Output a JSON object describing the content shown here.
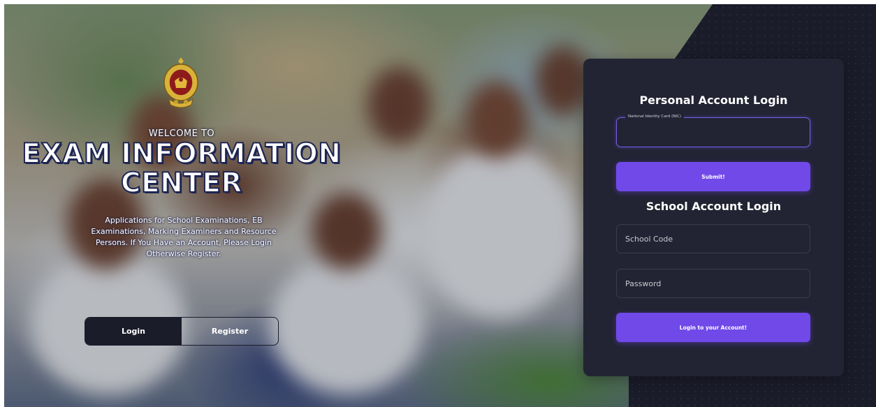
{
  "welcome": {
    "pre_title": "WELCOME TO",
    "title_line1": "EXAM INFORMATION",
    "title_line2": "CENTER",
    "description": "Applications for School Examinations, EB Examinations, Marking Examiners and Resource Persons. If You Have an Account, Please Login Otherwise Register.",
    "emblem_icon": "sri-lanka-emblem-icon"
  },
  "toggle": {
    "login_label": "Login",
    "register_label": "Register"
  },
  "personal_login": {
    "title": "Personal Account Login",
    "nic_label": "National Identity Card (NIC)",
    "nic_value": "",
    "submit_label": "Submit!"
  },
  "school_login": {
    "title": "School Account Login",
    "school_code_placeholder": "School Code",
    "password_placeholder": "Password",
    "submit_label": "Login to your Account!"
  },
  "colors": {
    "accent": "#7049e8",
    "card_bg": "#222433",
    "dark": "#1b1c2a",
    "title_outline": "#1d2552"
  }
}
